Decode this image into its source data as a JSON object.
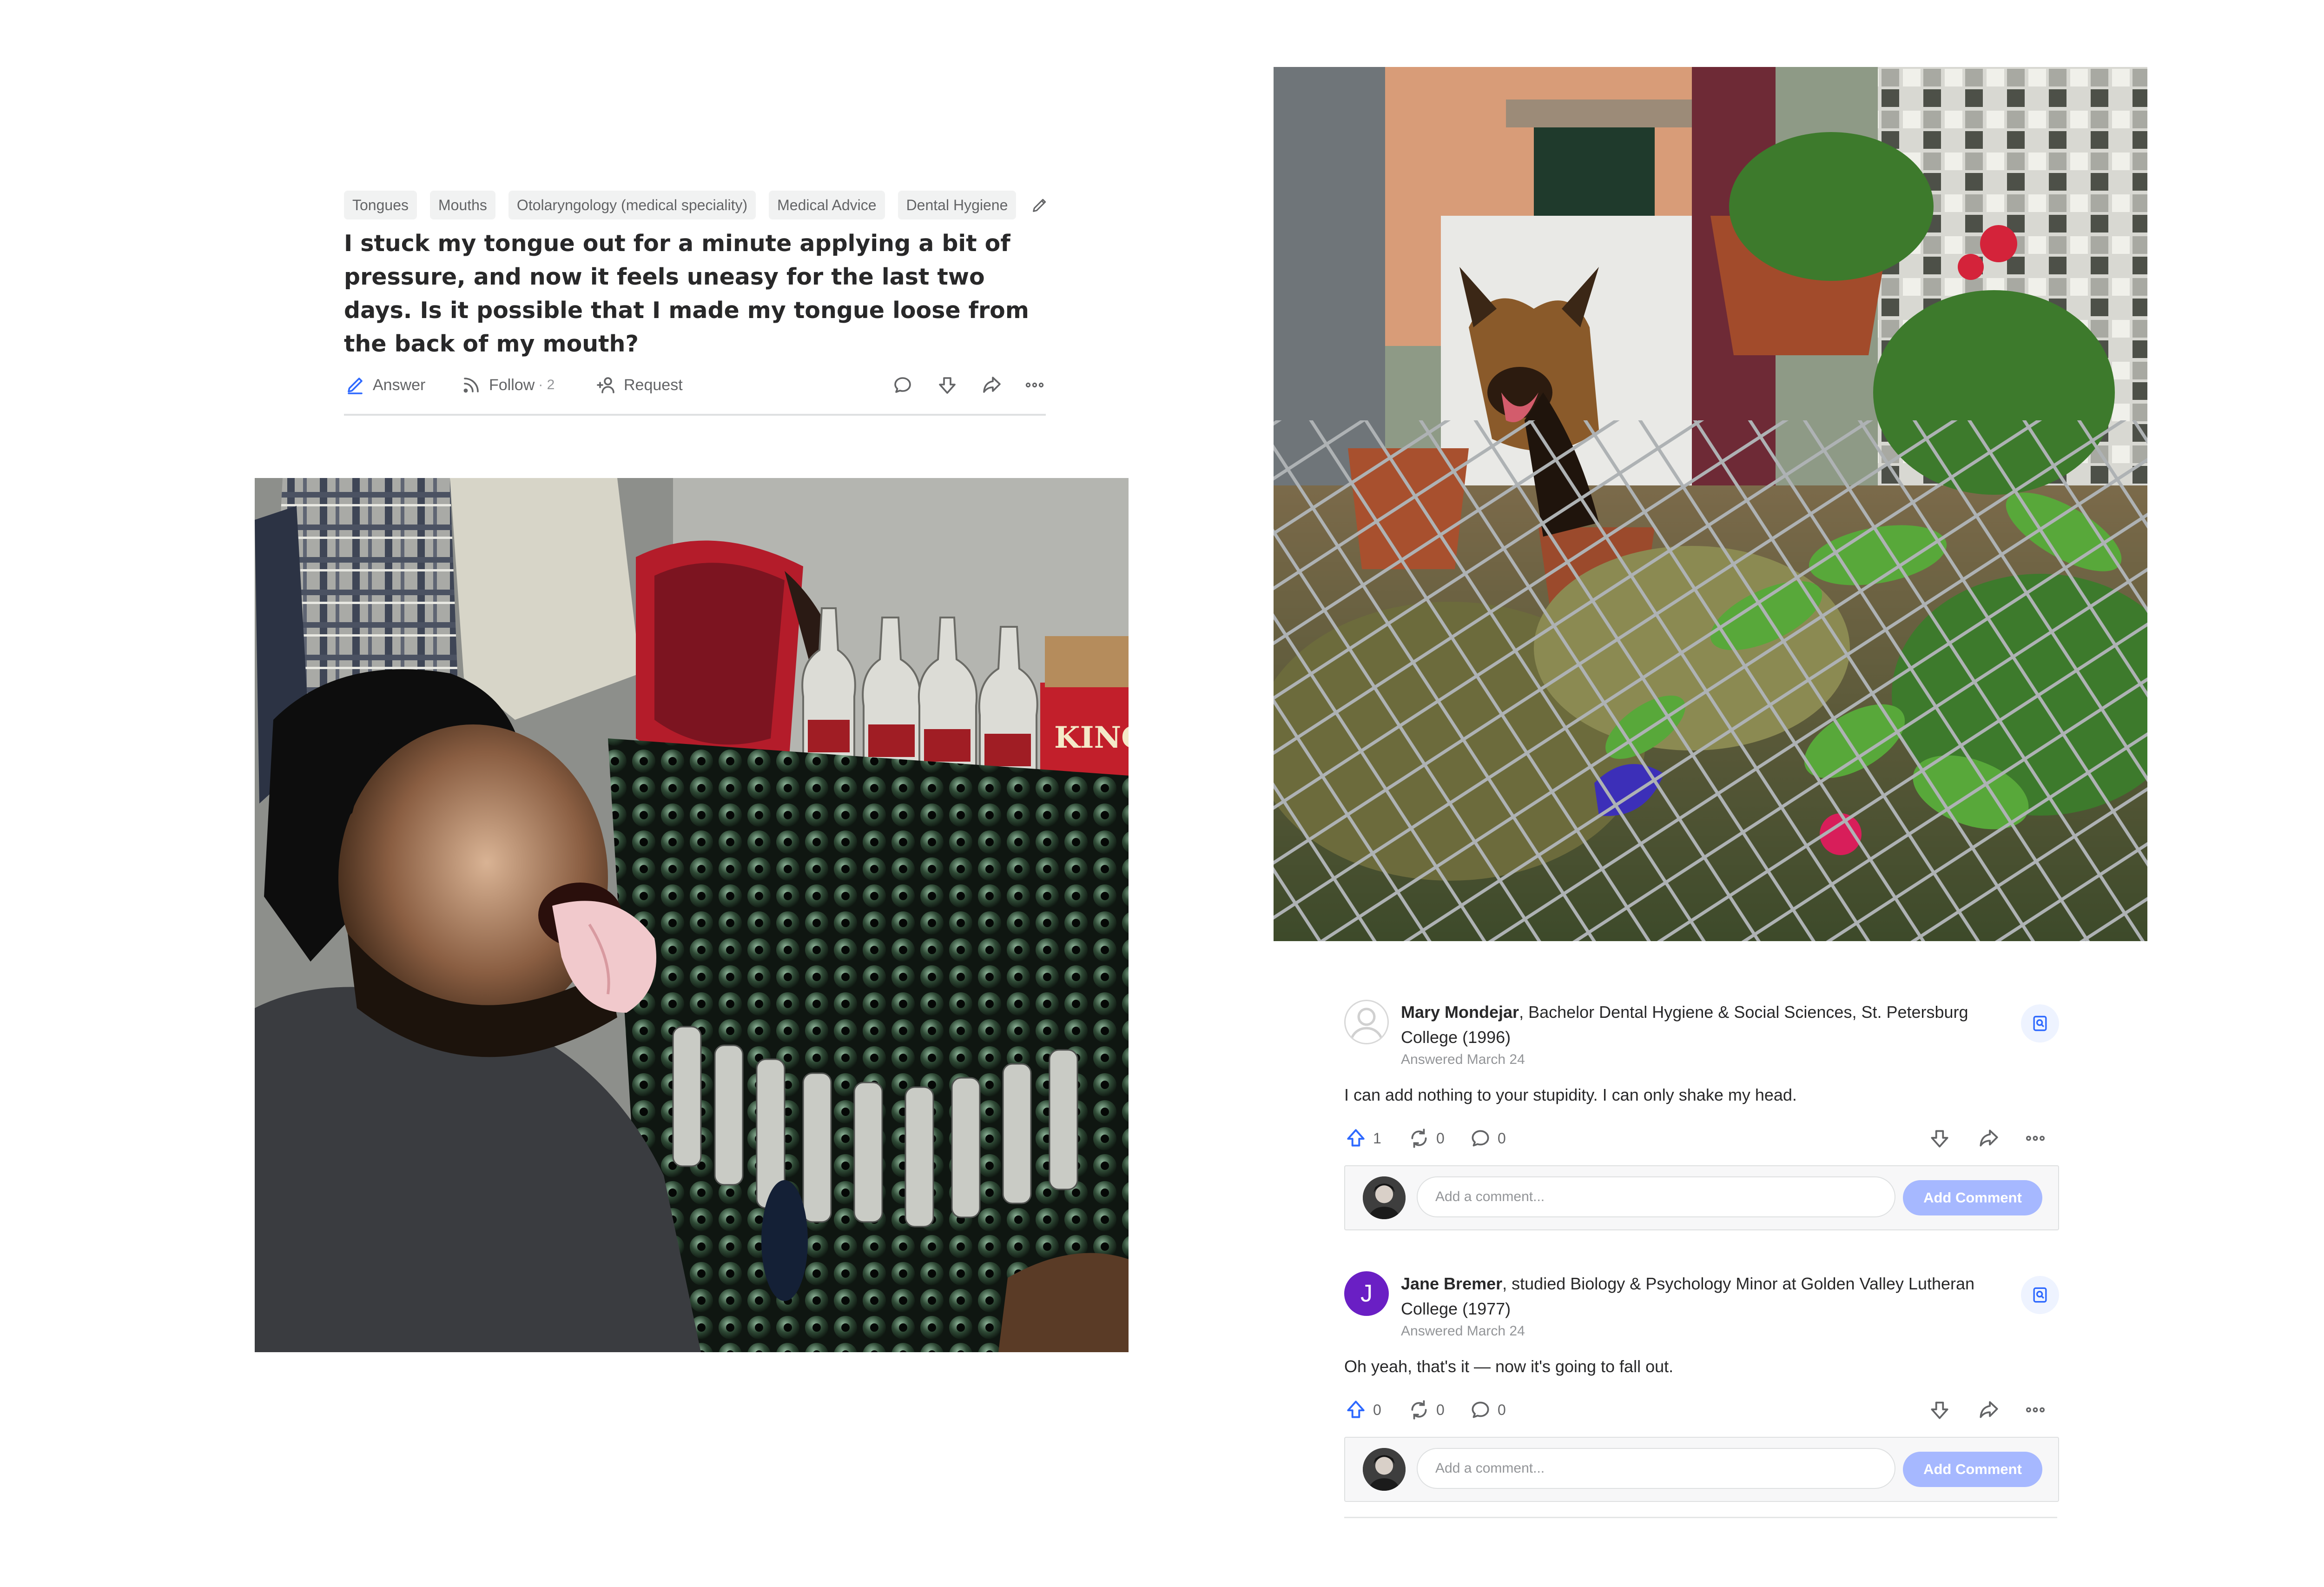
{
  "question": {
    "topics": [
      "Tongues",
      "Mouths",
      "Otolaryngology (medical speciality)",
      "Medical Advice",
      "Dental Hygiene"
    ],
    "title": "I stuck my tongue out for a minute applying a bit of pressure, and now it feels uneasy for the last two days. Is it possible that I made my tongue loose from the back of my mouth?",
    "actions": {
      "answer": "Answer",
      "follow": "Follow",
      "follow_count": "· 2",
      "request": "Request"
    }
  },
  "photos": {
    "left_kingfisher_text": "KINGFI"
  },
  "answers": [
    {
      "author": "Mary Mondejar",
      "credential": ", Bachelor Dental Hygiene & Social Sciences, St. Petersburg College (1996)",
      "date": "Answered March 24",
      "text": "I can add nothing to your stupidity. I can only shake my head.",
      "upvotes": "1",
      "shares": "0",
      "comments": "0",
      "avatar_letter": "",
      "comment_placeholder": "Add a comment...",
      "comment_button": "Add Comment"
    },
    {
      "author": "Jane Bremer",
      "credential": ", studied Biology & Psychology Minor at Golden Valley Lutheran College (1977)",
      "date": "Answered March 24",
      "text": "Oh yeah, that's it — now it's going to fall out.",
      "upvotes": "0",
      "shares": "0",
      "comments": "0",
      "avatar_letter": "J",
      "comment_placeholder": "Add a comment...",
      "comment_button": "Add Comment"
    }
  ],
  "colors": {
    "accent_blue": "#2e69ff",
    "button_disabled": "#a6b8ff",
    "avatar_purple": "#6a1fc4",
    "text": "#282829",
    "muted": "#636466"
  },
  "icons": [
    "pencil-icon",
    "answer-icon",
    "follow-icon",
    "request-icon",
    "comment-icon",
    "downvote-icon",
    "share-icon",
    "more-icon",
    "upvote-icon",
    "reshare-icon",
    "bookmark-icon"
  ]
}
